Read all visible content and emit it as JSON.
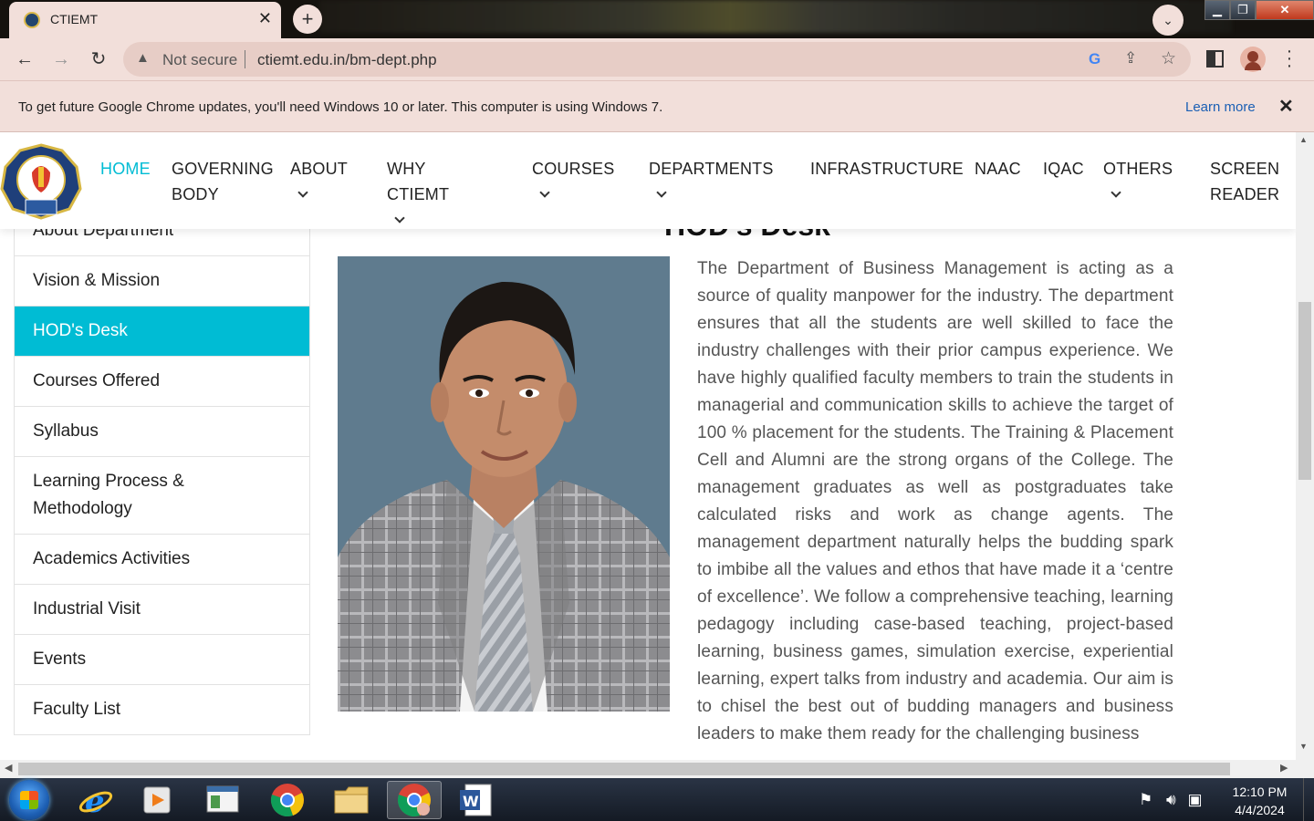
{
  "browser": {
    "tab_title": "CTIEMT",
    "security_label": "Not secure",
    "url": "ctiemt.edu.in/bm-dept.php",
    "infobar_message": "To get future Google Chrome updates, you'll need Windows 10 or later. This computer is using Windows 7.",
    "infobar_link": "Learn more"
  },
  "site": {
    "nav": [
      {
        "label": "HOME",
        "active": true
      },
      {
        "label": "GOVERNING",
        "label2": "BODY"
      },
      {
        "label": "ABOUT",
        "dropdown": true
      },
      {
        "label": "WHY CTIEMT",
        "dropdown": true
      },
      {
        "label": "COURSES",
        "dropdown": true
      },
      {
        "label": "DEPARTMENTS",
        "dropdown": true
      },
      {
        "label": "INFRASTRUCTURE"
      },
      {
        "label": "NAAC"
      },
      {
        "label": "IQAC"
      },
      {
        "label": "OTHERS",
        "dropdown": true
      },
      {
        "label": "SCREEN",
        "label2": "READER"
      }
    ],
    "sidebar": [
      "About Department",
      "Vision & Mission",
      "HOD's Desk",
      "Courses Offered",
      "Syllabus",
      "Learning Process & Methodology",
      "Academics Activities",
      "Industrial Visit",
      "Events",
      "Faculty List"
    ],
    "sidebar_active_index": 2,
    "section_title": "HOD's Desk",
    "paragraph": "The Department of Business Management is acting as a source of quality manpower for the industry. The department ensures that all the students are well skilled to face the industry challenges with their prior campus experience. We have highly qualified faculty members to train the students in managerial and communication skills to achieve the target of 100 % placement for the students. The Training & Placement Cell and Alumni are the strong organs of the College. The management graduates as well as postgraduates take calculated risks and work as change agents. The management department naturally helps the budding spark to imbibe all the values and ethos that have made it a ‘centre of excellence’. We follow a comprehensive teaching, learning pedagogy including case-based teaching, project-based learning, business games, simulation exercise, experiential learning, expert talks from industry and academia. Our aim is to chisel the best out of budding managers and business leaders to make them ready for the challenging business"
  },
  "taskbar": {
    "time": "12:10 PM",
    "date": "4/4/2024"
  },
  "colors": {
    "accent": "#00bcd4",
    "chrome_bg": "#f2dfda"
  }
}
